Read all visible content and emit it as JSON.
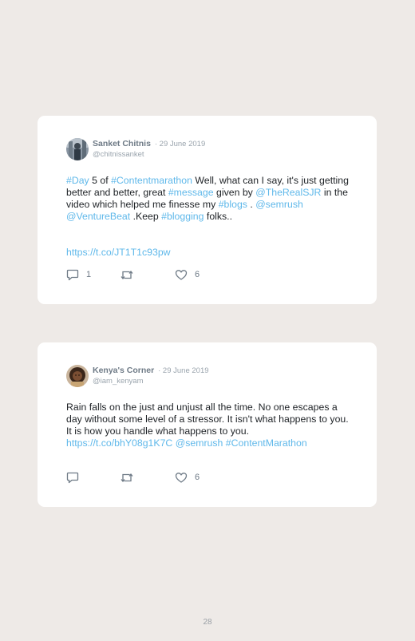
{
  "tweets": [
    {
      "author": "Sanket Chitnis",
      "date": "· 29 June 2019",
      "handle": "@chitnissanket",
      "body": {
        "t0": "#Day",
        "t1": " 5 of ",
        "t2": "#Contentmarathon",
        "t3": " Well, what can I say, it's just getting better and better, great ",
        "t4": "#message",
        "t5": " given by ",
        "t6": "@TheRealSJR",
        "t7": " in the video which helped me finesse my ",
        "t8": "#blogs",
        "t9": " . ",
        "t10": "@semrush",
        "t11": " ",
        "t12": "@VentureBeat",
        "t13": " .Keep ",
        "t14": "#blogging",
        "t15": " folks..",
        "url": "https://t.co/JT1T1c93pw"
      },
      "replies": "1",
      "retweets": "",
      "likes": "6"
    },
    {
      "author": "Kenya's Corner",
      "date": "· 29 June 2019",
      "handle": "@iam_kenyam",
      "body": {
        "t0": "Rain falls on the just and unjust all the time. No one escapes a day without some level of a stressor. It isn't what happens to you. It is how you handle what happens to you. ",
        "t1": "https://t.co/bhY08g1K7C",
        "t2": " ",
        "t3": "@semrush",
        "t4": " ",
        "t5": "#ContentMarathon"
      },
      "replies": "",
      "retweets": "",
      "likes": "6"
    }
  ],
  "page_number": "28",
  "icons": {
    "reply": "reply-icon",
    "retweet": "retweet-icon",
    "like": "heart-icon"
  },
  "colors": {
    "link": "#5fb8ea",
    "background": "#eeeae7",
    "card": "#ffffff",
    "meta": "#9aa4ad"
  }
}
